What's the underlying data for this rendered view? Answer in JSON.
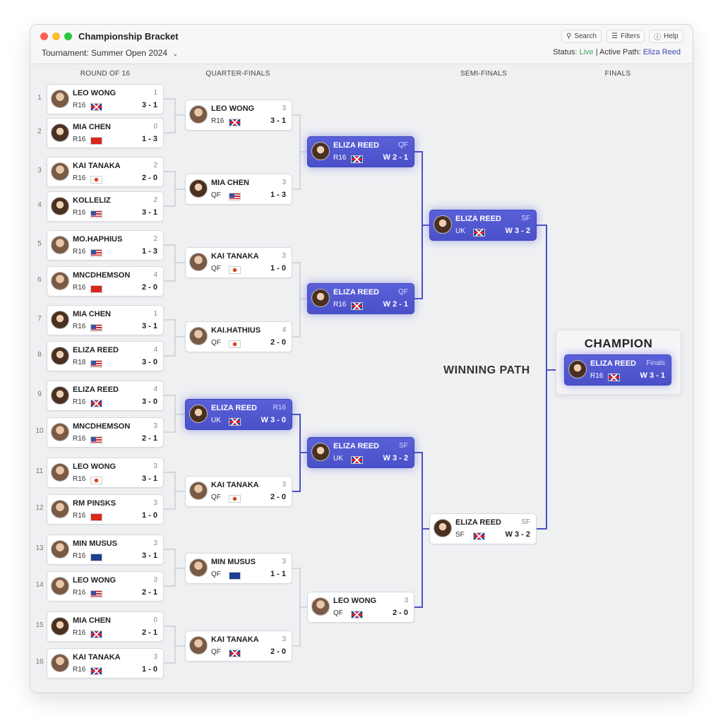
{
  "window": {
    "title": "Championship Bracket",
    "tournament_label": "Tournament: Summer Open 2024",
    "toolbar": {
      "search": "Search",
      "filters": "Filters",
      "help": "Help"
    },
    "status": {
      "prefix": "Status:",
      "live": "Live",
      "separator": "|",
      "path_prefix": "Active Path:",
      "path": "Eliza Reed"
    },
    "colors": {
      "accent": "#4a51c8",
      "live": "#3aa55a",
      "path": "#3e47b5"
    }
  },
  "rounds": [
    "ROUND OF 16",
    "QUARTER-FINALS",
    "SEMI-FINALS",
    "FINALS"
  ],
  "seeds": [
    "1",
    "2",
    "3",
    "4",
    "5",
    "6",
    "7",
    "8",
    "9",
    "10",
    "11",
    "12",
    "13",
    "14",
    "15",
    "16"
  ],
  "r16": [
    {
      "name": "LEO WONG",
      "tag": "1",
      "round": "R16",
      "flag": "uk",
      "score": "3 - 1"
    },
    {
      "name": "MIA CHEN",
      "tag": "0",
      "round": "R16",
      "flag": "cn",
      "score": "1 - 3"
    },
    {
      "name": "KAI TANAKA",
      "tag": "2",
      "round": "R16",
      "flag": "jp",
      "score": "2 - 0"
    },
    {
      "name": "KOLLELIZ",
      "tag": "2",
      "round": "R16",
      "flag": "us",
      "score": "3 - 1"
    },
    {
      "name": "MO.HAPHIUS",
      "tag": "2",
      "round": "R16",
      "flag": "us",
      "score": "1 - 3"
    },
    {
      "name": "MNCDHEMSON",
      "tag": "4",
      "round": "R16",
      "flag": "cn",
      "score": "2 - 0"
    },
    {
      "name": "MIA CHEN",
      "tag": "1",
      "round": "R16",
      "flag": "us",
      "score": "3 - 1"
    },
    {
      "name": "ELIZA REED",
      "tag": "4",
      "round": "R18",
      "flag": "us",
      "score": "3 - 0"
    },
    {
      "name": "ELIZA REED",
      "tag": "4",
      "round": "R16",
      "flag": "uk",
      "score": "3 - 0"
    },
    {
      "name": "MNCDHEMSON",
      "tag": "3",
      "round": "R16",
      "flag": "us",
      "score": "2 - 1"
    },
    {
      "name": "LEO WONG",
      "tag": "3",
      "round": "R16",
      "flag": "jp",
      "score": "3 - 1"
    },
    {
      "name": "RM PINSKS",
      "tag": "3",
      "round": "R16",
      "flag": "cn",
      "score": "1 - 0"
    },
    {
      "name": "MIN MUSUS",
      "tag": "3",
      "round": "R16",
      "flag": "au",
      "score": "3 - 1"
    },
    {
      "name": "LEO WONG",
      "tag": "3",
      "round": "R16",
      "flag": "us",
      "score": "2 - 1"
    },
    {
      "name": "MIA CHEN",
      "tag": "0",
      "round": "R16",
      "flag": "uk",
      "score": "2 - 1"
    },
    {
      "name": "KAI TANAKA",
      "tag": "3",
      "round": "R16",
      "flag": "uk",
      "score": "1 - 0"
    }
  ],
  "qf": [
    {
      "name": "LEO WONG",
      "tag": "3",
      "round": "R16",
      "flag": "uk",
      "score": "3 - 1"
    },
    {
      "name": "MIA CHEN",
      "tag": "3",
      "round": "QF",
      "flag": "us",
      "score": "1 - 3"
    },
    {
      "name": "KAI TANAKA",
      "tag": "3",
      "round": "QF",
      "flag": "jp",
      "score": "1 - 0"
    },
    {
      "name": "KAI.HATHIUS",
      "tag": "4",
      "round": "QF",
      "flag": "jp",
      "score": "2 - 0"
    },
    {
      "name": "ELIZA REED",
      "tag": "R16",
      "round": "UK",
      "flag": "uk",
      "score": "W 3 - 0"
    },
    {
      "name": "KAI TANAKA",
      "tag": "3",
      "round": "QF",
      "flag": "jp",
      "score": "2 - 0"
    },
    {
      "name": "MIN MUSUS",
      "tag": "3",
      "round": "QF",
      "flag": "au",
      "score": "1 - 1"
    },
    {
      "name": "KAI TANAKA",
      "tag": "3",
      "round": "QF",
      "flag": "uk",
      "score": "2 - 0"
    }
  ],
  "sf": [
    {
      "name": "ELIZA REED",
      "tag": "QF",
      "round": "R16",
      "flag": "uk",
      "score": "W 2 - 1"
    },
    {
      "name": "ELIZA REED",
      "tag": "QF",
      "round": "R16",
      "flag": "uk",
      "score": "W 2 - 1"
    },
    {
      "name": "ELIZA REED",
      "tag": "SF",
      "round": "UK",
      "flag": "uk",
      "score": "W 3 - 2"
    },
    {
      "name": "LEO WONG",
      "tag": "3",
      "round": "QF",
      "flag": "uk",
      "score": "2 - 0"
    }
  ],
  "final_round": [
    {
      "name": "ELIZA REED",
      "tag": "SF",
      "round": "UK",
      "flag": "uk",
      "score": "W 3 - 2"
    },
    {
      "name": "ELIZA REED",
      "tag": "SF",
      "round": "SF",
      "flag": "uk",
      "score": "W 3 - 2"
    }
  ],
  "champion": {
    "title": "CHAMPION",
    "card": {
      "name": "ELIZA REED",
      "tag": "Finals",
      "round": "R16",
      "flag": "uk",
      "score": "W 3 - 1"
    }
  },
  "winning_path_label": "WINNING PATH"
}
